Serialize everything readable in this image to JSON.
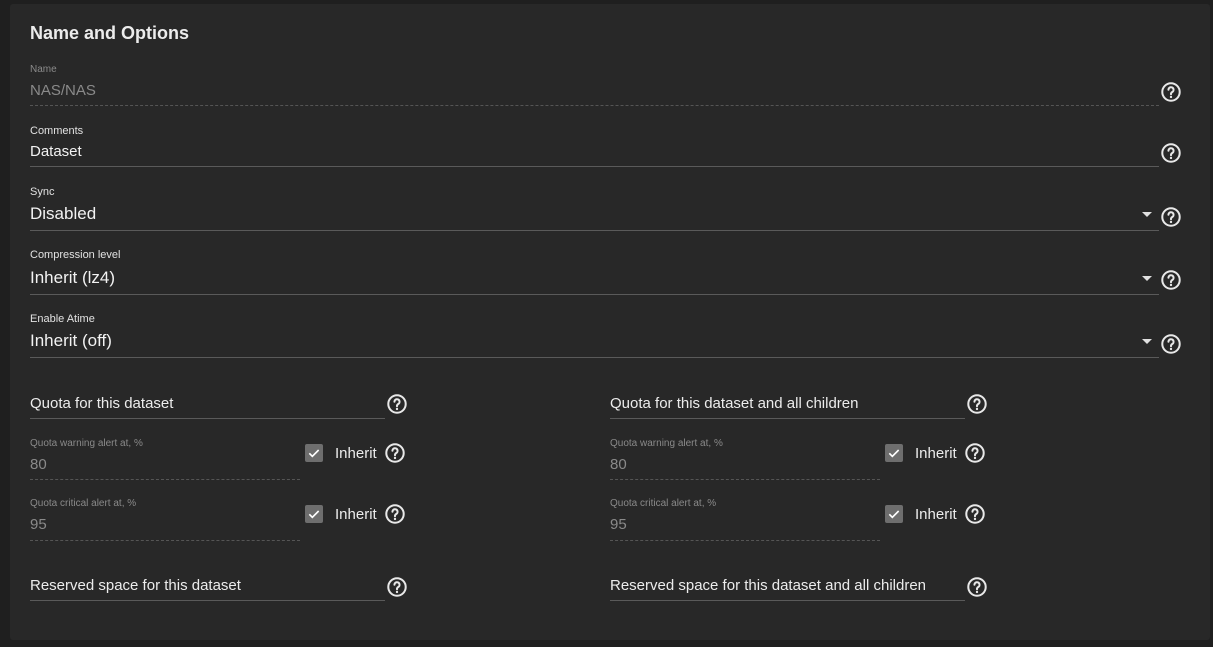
{
  "section": {
    "title": "Name and Options"
  },
  "fields": {
    "name": {
      "label": "Name",
      "value": "NAS/NAS"
    },
    "comments": {
      "label": "Comments",
      "value": "Dataset"
    },
    "sync": {
      "label": "Sync",
      "value": "Disabled"
    },
    "compression": {
      "label": "Compression level",
      "value": "Inherit (lz4)"
    },
    "atime": {
      "label": "Enable Atime",
      "value": "Inherit (off)"
    }
  },
  "quota_left": {
    "title": "Quota for this dataset",
    "warning": {
      "label": "Quota warning alert at, %",
      "value": "80",
      "inherit_label": "Inherit",
      "inherit_checked": true
    },
    "critical": {
      "label": "Quota critical alert at, %",
      "value": "95",
      "inherit_label": "Inherit",
      "inherit_checked": true
    },
    "reserved": "Reserved space for this dataset"
  },
  "quota_right": {
    "title": "Quota for this dataset and all children",
    "warning": {
      "label": "Quota warning alert at, %",
      "value": "80",
      "inherit_label": "Inherit",
      "inherit_checked": true
    },
    "critical": {
      "label": "Quota critical alert at, %",
      "value": "95",
      "inherit_label": "Inherit",
      "inherit_checked": true
    },
    "reserved": "Reserved space for this dataset and all children"
  },
  "icons": {
    "help": "help-circle-icon",
    "dropdown": "caret-down-icon",
    "check": "check-icon"
  },
  "colors": {
    "page_bg": "#1f1f1f",
    "card_bg": "#282828",
    "text": "#f2f2f2",
    "muted_text": "#8a8a8a",
    "underline": "#5a5a5a",
    "checkbox": "#6e6e6e"
  }
}
